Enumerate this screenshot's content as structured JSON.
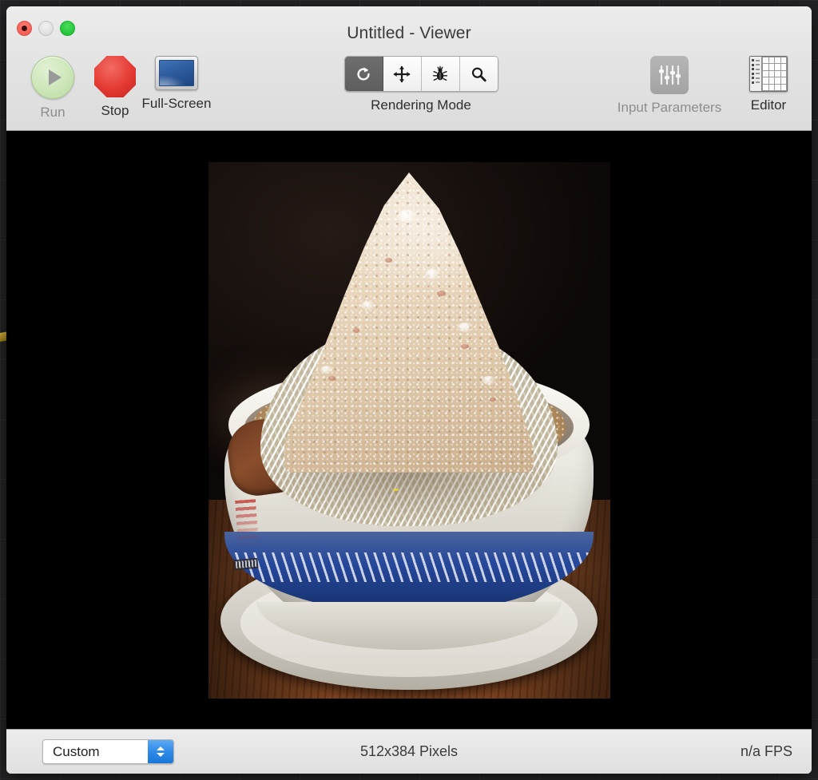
{
  "window": {
    "title": "Untitled - Viewer",
    "controls": {
      "close": "close-button",
      "minimize": "minimize-button",
      "zoom": "zoom-button"
    }
  },
  "toolbar": {
    "run": {
      "label": "Run",
      "icon": "play-icon",
      "enabled": false
    },
    "stop": {
      "label": "Stop",
      "icon": "stop-octagon-icon",
      "enabled": true
    },
    "fullscreen": {
      "label": "Full-Screen",
      "icon": "display-icon",
      "enabled": true
    },
    "rendering_mode": {
      "label": "Rendering Mode",
      "segments": [
        {
          "name": "refresh-icon",
          "selected": true
        },
        {
          "name": "move-icon",
          "selected": false
        },
        {
          "name": "bug-icon",
          "selected": false
        },
        {
          "name": "magnifier-icon",
          "selected": false
        }
      ]
    },
    "input_parameters": {
      "label": "Input Parameters",
      "icon": "sliders-icon",
      "enabled": false
    },
    "editor": {
      "label": "Editor",
      "icon": "table-editor-icon",
      "enabled": true
    }
  },
  "statusbar": {
    "preset": {
      "value": "Custom",
      "stepper": "stepper-control"
    },
    "dimensions": "512x384 Pixels",
    "fps": "n/a FPS"
  },
  "canvas": {
    "description": "photograph of a bowl of Jiro-style ramen topped with a tall mound of minced garlic and fat over bean sprouts, in a white ceramic bowl with a blue thunder-pattern band, on a wooden table",
    "background": "#000000"
  },
  "colors": {
    "toolbar_bg": "#e6e6e6",
    "canvas_bg": "#000000",
    "accent_blue": "#2f8ae8",
    "stop_red": "#e33a32",
    "run_green": "#cde6b8",
    "segment_selected": "#6e6e6e"
  }
}
